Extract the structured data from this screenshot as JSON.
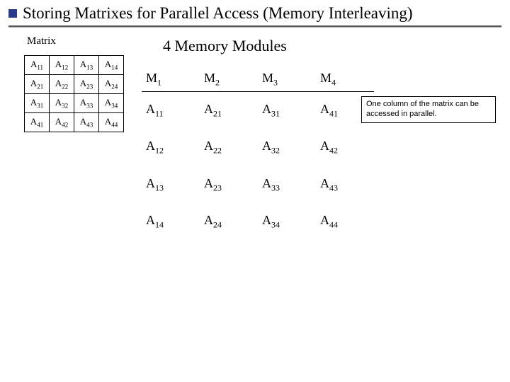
{
  "title": "Storing Matrixes for Parallel Access (Memory Interleaving)",
  "matrix_label": "Matrix",
  "matrix": {
    "rows": [
      [
        {
          "b": "A",
          "s": "11"
        },
        {
          "b": "A",
          "s": "12"
        },
        {
          "b": "A",
          "s": "13"
        },
        {
          "b": "A",
          "s": "14"
        }
      ],
      [
        {
          "b": "A",
          "s": "21"
        },
        {
          "b": "A",
          "s": "22"
        },
        {
          "b": "A",
          "s": "23"
        },
        {
          "b": "A",
          "s": "24"
        }
      ],
      [
        {
          "b": "A",
          "s": "31"
        },
        {
          "b": "A",
          "s": "32"
        },
        {
          "b": "A",
          "s": "33"
        },
        {
          "b": "A",
          "s": "34"
        }
      ],
      [
        {
          "b": "A",
          "s": "41"
        },
        {
          "b": "A",
          "s": "42"
        },
        {
          "b": "A",
          "s": "43"
        },
        {
          "b": "A",
          "s": "44"
        }
      ]
    ]
  },
  "modules_title": "4 Memory Modules",
  "modules": {
    "headers": [
      {
        "b": "M",
        "s": "1"
      },
      {
        "b": "M",
        "s": "2"
      },
      {
        "b": "M",
        "s": "3"
      },
      {
        "b": "M",
        "s": "4"
      }
    ],
    "rows": [
      [
        {
          "b": "A",
          "s": "11"
        },
        {
          "b": "A",
          "s": "21"
        },
        {
          "b": "A",
          "s": "31"
        },
        {
          "b": "A",
          "s": "41"
        }
      ],
      [
        {
          "b": "A",
          "s": "12"
        },
        {
          "b": "A",
          "s": "22"
        },
        {
          "b": "A",
          "s": "32"
        },
        {
          "b": "A",
          "s": "42"
        }
      ],
      [
        {
          "b": "A",
          "s": "13"
        },
        {
          "b": "A",
          "s": "23"
        },
        {
          "b": "A",
          "s": "33"
        },
        {
          "b": "A",
          "s": "43"
        }
      ],
      [
        {
          "b": "A",
          "s": "14"
        },
        {
          "b": "A",
          "s": "24"
        },
        {
          "b": "A",
          "s": "34"
        },
        {
          "b": "A",
          "s": "44"
        }
      ]
    ]
  },
  "note": "One column of the matrix can be accessed in parallel."
}
